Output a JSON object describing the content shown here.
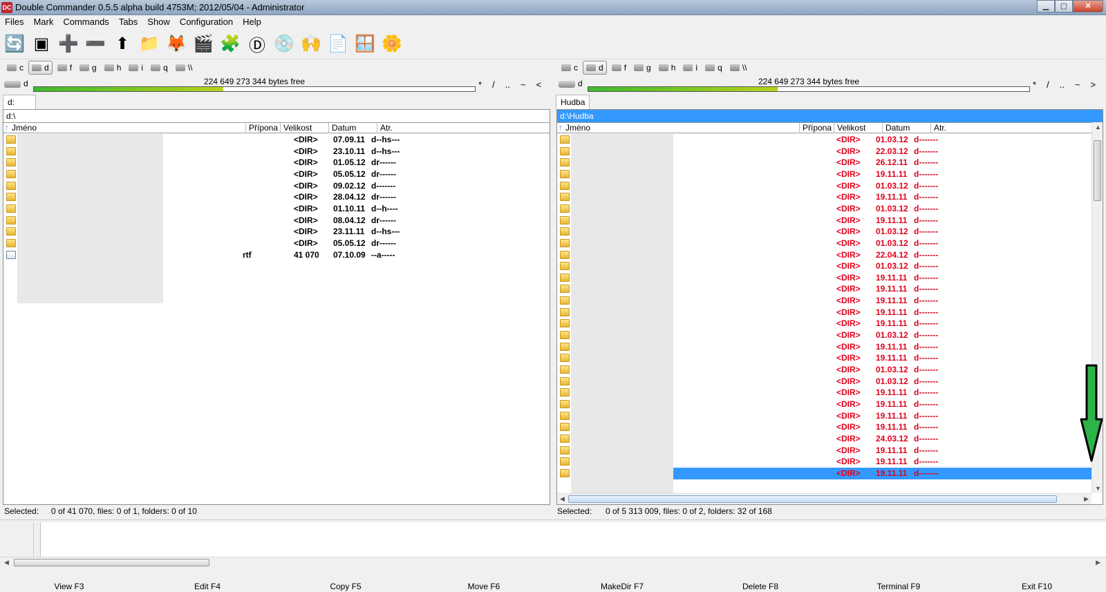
{
  "window": {
    "title": "Double Commander 0.5.5 alpha build 4753M; 2012/05/04 - Administrator",
    "icon_text": "DC",
    "controls": [
      "minimize-icon",
      "maximize-icon",
      "close-icon"
    ]
  },
  "menu": [
    "Files",
    "Mark",
    "Commands",
    "Tabs",
    "Show",
    "Configuration",
    "Help"
  ],
  "toolbar": [
    {
      "name": "refresh-icon",
      "glyph": "🔄"
    },
    {
      "name": "terminal-icon",
      "glyph": "▣"
    },
    {
      "name": "plus-icon",
      "glyph": "➕"
    },
    {
      "name": "minus-icon",
      "glyph": "➖"
    },
    {
      "name": "go-up-icon",
      "glyph": "⬆"
    },
    {
      "name": "folder-icon",
      "glyph": "📁"
    },
    {
      "name": "gimp-icon",
      "glyph": "🦊"
    },
    {
      "name": "clapper-icon",
      "glyph": "🎬"
    },
    {
      "name": "puzzle-icon",
      "glyph": "🧩"
    },
    {
      "name": "media-d-icon",
      "glyph": "Ⓓ"
    },
    {
      "name": "infra-recorder-icon",
      "glyph": "💿"
    },
    {
      "name": "hands-icon",
      "glyph": "🙌"
    },
    {
      "name": "pdf-icon",
      "glyph": "📄"
    },
    {
      "name": "windows-icon",
      "glyph": "🪟"
    },
    {
      "name": "gear-flower-icon",
      "glyph": "🌼"
    }
  ],
  "drives": [
    "c",
    "d",
    "f",
    "g",
    "h",
    "i",
    "q",
    "\\\\"
  ],
  "left": {
    "drive_label": "d",
    "free_text": "224 649 273 344 bytes free",
    "free_fraction": 0.43,
    "nav_chars": [
      "*",
      "/",
      "..",
      "~",
      "<"
    ],
    "tab": "d:",
    "path": "d:\\",
    "columns": [
      "Jméno",
      "Přípona",
      "Velikost",
      "Datum",
      "Atr."
    ],
    "rows": [
      {
        "ext": "",
        "size": "<DIR>",
        "date": "07.09.11",
        "attr": "d--hs---"
      },
      {
        "ext": "",
        "size": "<DIR>",
        "date": "23.10.11",
        "attr": "d--hs---"
      },
      {
        "ext": "",
        "size": "<DIR>",
        "date": "01.05.12",
        "attr": "dr------"
      },
      {
        "ext": "",
        "size": "<DIR>",
        "date": "05.05.12",
        "attr": "dr------"
      },
      {
        "ext": "",
        "size": "<DIR>",
        "date": "09.02.12",
        "attr": "d-------"
      },
      {
        "ext": "",
        "size": "<DIR>",
        "date": "28.04.12",
        "attr": "dr------"
      },
      {
        "ext": "",
        "size": "<DIR>",
        "date": "01.10.11",
        "attr": "d--h----"
      },
      {
        "ext": "",
        "size": "<DIR>",
        "date": "08.04.12",
        "attr": "dr------"
      },
      {
        "ext": "",
        "size": "<DIR>",
        "date": "23.11.11",
        "attr": "d--hs---"
      },
      {
        "ext": "",
        "size": "<DIR>",
        "date": "05.05.12",
        "attr": "dr------"
      },
      {
        "ext": "rtf",
        "size": "41 070",
        "date": "07.10.09",
        "attr": "--a-----",
        "file": true
      }
    ],
    "status_label": "Selected:",
    "status": "0 of  41 070, files: 0 of 1, folders: 0 of 10"
  },
  "right": {
    "drive_label": "d",
    "free_text": "224 649 273 344 bytes free",
    "free_fraction": 0.43,
    "nav_chars": [
      "*",
      "/",
      "..",
      "~",
      ">"
    ],
    "tab": "Hudba",
    "path": "d:\\Hudba",
    "columns": [
      "Jméno",
      "Přípona",
      "Velikost",
      "Datum",
      "Atr."
    ],
    "rows": [
      {
        "size": "<DIR>",
        "date": "01.03.12",
        "attr": "d-------"
      },
      {
        "size": "<DIR>",
        "date": "22.03.12",
        "attr": "d-------"
      },
      {
        "size": "<DIR>",
        "date": "26.12.11",
        "attr": "d-------"
      },
      {
        "size": "<DIR>",
        "date": "19.11.11",
        "attr": "d-------"
      },
      {
        "size": "<DIR>",
        "date": "01.03.12",
        "attr": "d-------"
      },
      {
        "size": "<DIR>",
        "date": "19.11.11",
        "attr": "d-------"
      },
      {
        "size": "<DIR>",
        "date": "01.03.12",
        "attr": "d-------"
      },
      {
        "size": "<DIR>",
        "date": "19.11.11",
        "attr": "d-------"
      },
      {
        "size": "<DIR>",
        "date": "01.03.12",
        "attr": "d-------"
      },
      {
        "size": "<DIR>",
        "date": "01.03.12",
        "attr": "d-------"
      },
      {
        "size": "<DIR>",
        "date": "22.04.12",
        "attr": "d-------"
      },
      {
        "size": "<DIR>",
        "date": "01.03.12",
        "attr": "d-------"
      },
      {
        "size": "<DIR>",
        "date": "19.11.11",
        "attr": "d-------"
      },
      {
        "size": "<DIR>",
        "date": "19.11.11",
        "attr": "d-------"
      },
      {
        "size": "<DIR>",
        "date": "19.11.11",
        "attr": "d-------"
      },
      {
        "size": "<DIR>",
        "date": "19.11.11",
        "attr": "d-------"
      },
      {
        "size": "<DIR>",
        "date": "19.11.11",
        "attr": "d-------"
      },
      {
        "size": "<DIR>",
        "date": "01.03.12",
        "attr": "d-------"
      },
      {
        "size": "<DIR>",
        "date": "19.11.11",
        "attr": "d-------"
      },
      {
        "size": "<DIR>",
        "date": "19.11.11",
        "attr": "d-------"
      },
      {
        "size": "<DIR>",
        "date": "01.03.12",
        "attr": "d-------"
      },
      {
        "size": "<DIR>",
        "date": "01.03.12",
        "attr": "d-------"
      },
      {
        "size": "<DIR>",
        "date": "19.11.11",
        "attr": "d-------"
      },
      {
        "size": "<DIR>",
        "date": "19.11.11",
        "attr": "d-------"
      },
      {
        "size": "<DIR>",
        "date": "19.11.11",
        "attr": "d-------"
      },
      {
        "size": "<DIR>",
        "date": "19.11.11",
        "attr": "d-------"
      },
      {
        "size": "<DIR>",
        "date": "24.03.12",
        "attr": "d-------"
      },
      {
        "size": "<DIR>",
        "date": "19.11.11",
        "attr": "d-------"
      },
      {
        "size": "<DIR>",
        "date": "19.11.11",
        "attr": "d-------"
      },
      {
        "size": "<DIR>",
        "date": "19.11.11",
        "attr": "d-------",
        "selected": true
      }
    ],
    "status_label": "Selected:",
    "status": "0 of 5 313 009, files: 0 of 2, folders: 32 of 168"
  },
  "function_keys": [
    "View F3",
    "Edit F4",
    "Copy F5",
    "Move F6",
    "MakeDir F7",
    "Delete F8",
    "Terminal F9",
    "Exit F10"
  ],
  "colors": {
    "selection": "#3399ff",
    "red_text": "#e0001b",
    "gauge_green": "#3cbb2c",
    "arrow_green": "#2db34a"
  }
}
